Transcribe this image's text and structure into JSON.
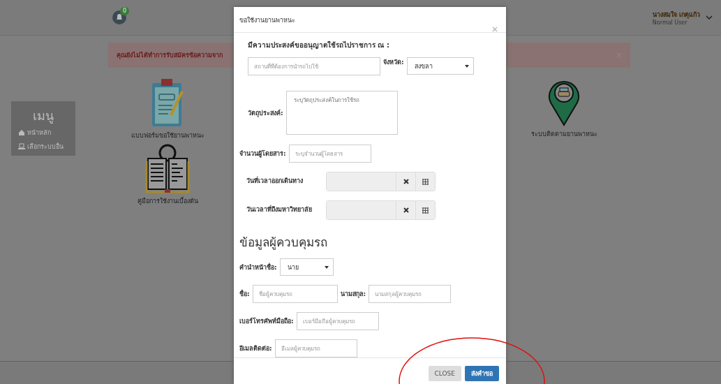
{
  "header": {
    "notification_count": "0",
    "user_name": "นางสมใจ เกตุแก้ว",
    "user_role": "Normal User"
  },
  "alert": {
    "text": "คุณยังไม่ได้ทำการรับสมัครข้อความจาก"
  },
  "sidebar": {
    "title": "เมนู",
    "items": [
      {
        "label": "หน้าหลัก",
        "kind": "home"
      },
      {
        "label": "เลือกระบบอื่น",
        "kind": "laptop"
      }
    ]
  },
  "tiles": [
    {
      "label": "แบบฟอร์มขอใช้ยานพาหนะ",
      "kind": "form"
    },
    {
      "label": "ระบบติดตามยานพาหนะ",
      "kind": "tracking"
    },
    {
      "label": "คู่มือการใช้งานเบื้องต้น",
      "kind": "manual"
    }
  ],
  "modal": {
    "title": "ขอใช้งานยานพาหนะ",
    "intro": "มีความประสงค์ขออนุญาตใช้รถไปราชการ ณ :",
    "destination": {
      "placeholder": "สถานที่ที่ต้องการนำรถไปใช้"
    },
    "province": {
      "label": "จังหวัด:",
      "value": "สงขลา"
    },
    "purpose": {
      "label": "วัตถุประสงค์:",
      "placeholder": "ระบุวัตถุประสงค์ในการใช้รถ"
    },
    "passengers": {
      "label": "จำนวนผู้โดยสาร:",
      "placeholder": "ระบุจำนวนผู้โดยสาร"
    },
    "dates": [
      {
        "label": "วันที่เวลาออกเดินทาง"
      },
      {
        "label": "วันเวลาที่ถึงมหาวิทยาลัย"
      }
    ],
    "driver_heading": "ข้อมูลผู้ควบคุมรถ",
    "prefix": {
      "label": "คำนำหน้าชื่อ:",
      "value": "นาย"
    },
    "first_name": {
      "label": "ชื่อ:",
      "placeholder": "ชื่อผู้ควบคุมรถ"
    },
    "last_name": {
      "label": "นามสกุล:",
      "placeholder": "นามสกุลผู้ควบคุมรถ"
    },
    "phone": {
      "label": "เบอร์โทรศัพท์มือถือ:",
      "placeholder": "เบอร์มือถือผู้ควบคุมรถ"
    },
    "email": {
      "label": "อีเมลติดต่อ:",
      "placeholder": "อีเมลผู้ควบคุมรถ"
    },
    "buttons": [
      {
        "label": "CLOSE",
        "kind": "default"
      },
      {
        "label": "ส่งคำขอ",
        "kind": "primary"
      }
    ]
  }
}
